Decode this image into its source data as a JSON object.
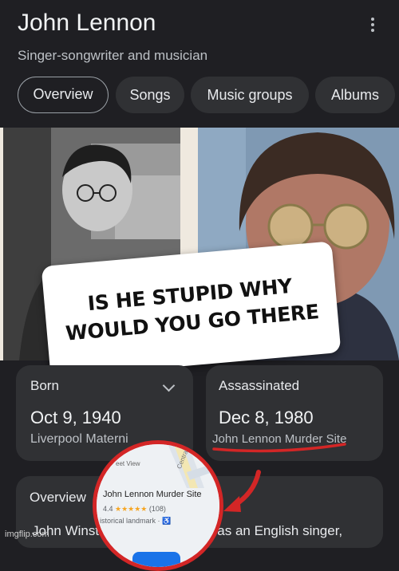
{
  "header": {
    "title": "John Lennon",
    "subtitle": "Singer-songwriter and musician"
  },
  "tabs": [
    {
      "label": "Overview",
      "active": true
    },
    {
      "label": "Songs",
      "active": false
    },
    {
      "label": "Music groups",
      "active": false
    },
    {
      "label": "Albums",
      "active": false
    }
  ],
  "meme_caption": {
    "line1": "IS HE STUPID WHY",
    "line2": "WOULD YOU GO THERE"
  },
  "cards": {
    "born": {
      "label": "Born",
      "value": "Oct 9, 1940",
      "sub": "Liverpool Materni"
    },
    "assassinated": {
      "label": "Assassinated",
      "value": "Dec 8, 1980",
      "sub": "John Lennon Murder Site"
    }
  },
  "overview_card": {
    "label": "Overview",
    "text_left": "John Winst",
    "text_right": "was an English singer,"
  },
  "map_popup": {
    "street_view": "eet View",
    "road": "Central",
    "place_name": "John Lennon Murder Site",
    "rating": "4.4",
    "stars": "★★★★★",
    "reviews": "(108)",
    "category": "istorical landmark · ♿"
  },
  "watermark": "imgflip.com",
  "colors": {
    "background": "#1f1f23",
    "card": "#303134",
    "annotation_red": "#d32626",
    "star": "#f6a623"
  }
}
